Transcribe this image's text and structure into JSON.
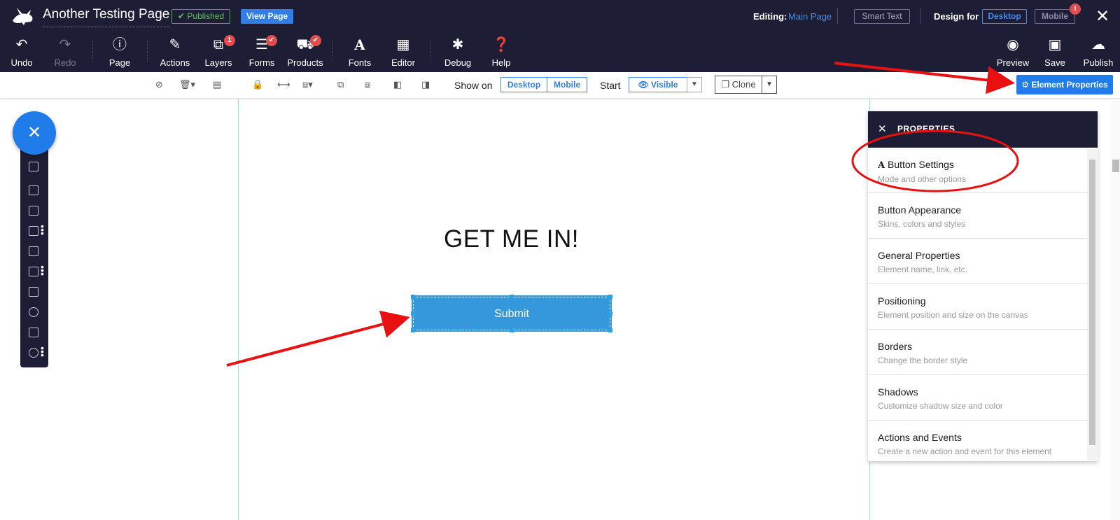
{
  "header": {
    "page_title": "Another Testing Page",
    "published_label": "Published",
    "view_page_label": "View Page",
    "editing_label": "Editing:",
    "editing_page": "Main Page",
    "smart_text_label": "Smart Text",
    "design_for_label": "Design for",
    "desktop_label": "Desktop",
    "mobile_label": "Mobile",
    "mobile_alert": "!"
  },
  "toolbar": {
    "undo": "Undo",
    "redo": "Redo",
    "page": "Page",
    "actions": "Actions",
    "layers": "Layers",
    "layers_badge": "1",
    "forms": "Forms",
    "products": "Products",
    "fonts": "Fonts",
    "editor": "Editor",
    "debug": "Debug",
    "help": "Help",
    "preview": "Preview",
    "save": "Save",
    "publish": "Publish"
  },
  "subtoolbar": {
    "show_on_label": "Show on",
    "show_desktop": "Desktop",
    "show_mobile": "Mobile",
    "start_label": "Start",
    "visible_label": "Visible",
    "clone_label": "Clone",
    "element_properties_label": "Element Properties"
  },
  "canvas": {
    "headline": "GET ME IN!",
    "submit_label": "Submit"
  },
  "properties_panel": {
    "title": "PROPERTIES",
    "items": [
      {
        "title": "Button Settings",
        "subtitle": "Mode and other options",
        "icon": "font-a-icon"
      },
      {
        "title": "Button Appearance",
        "subtitle": "Skins, colors and styles"
      },
      {
        "title": "General Properties",
        "subtitle": "Element name, link, etc."
      },
      {
        "title": "Positioning",
        "subtitle": "Element position and size on the canvas"
      },
      {
        "title": "Borders",
        "subtitle": "Change the border style"
      },
      {
        "title": "Shadows",
        "subtitle": "Customize shadow size and color"
      },
      {
        "title": "Actions and Events",
        "subtitle": "Create a new action and event for this element"
      }
    ]
  },
  "colors": {
    "topbar_bg": "#1d1e36",
    "accent_blue": "#1f7ce8",
    "submit_blue": "#3598dc",
    "published_green": "#5cc55c",
    "alert_red": "#e24c4c",
    "annotation_red": "#e81010"
  }
}
